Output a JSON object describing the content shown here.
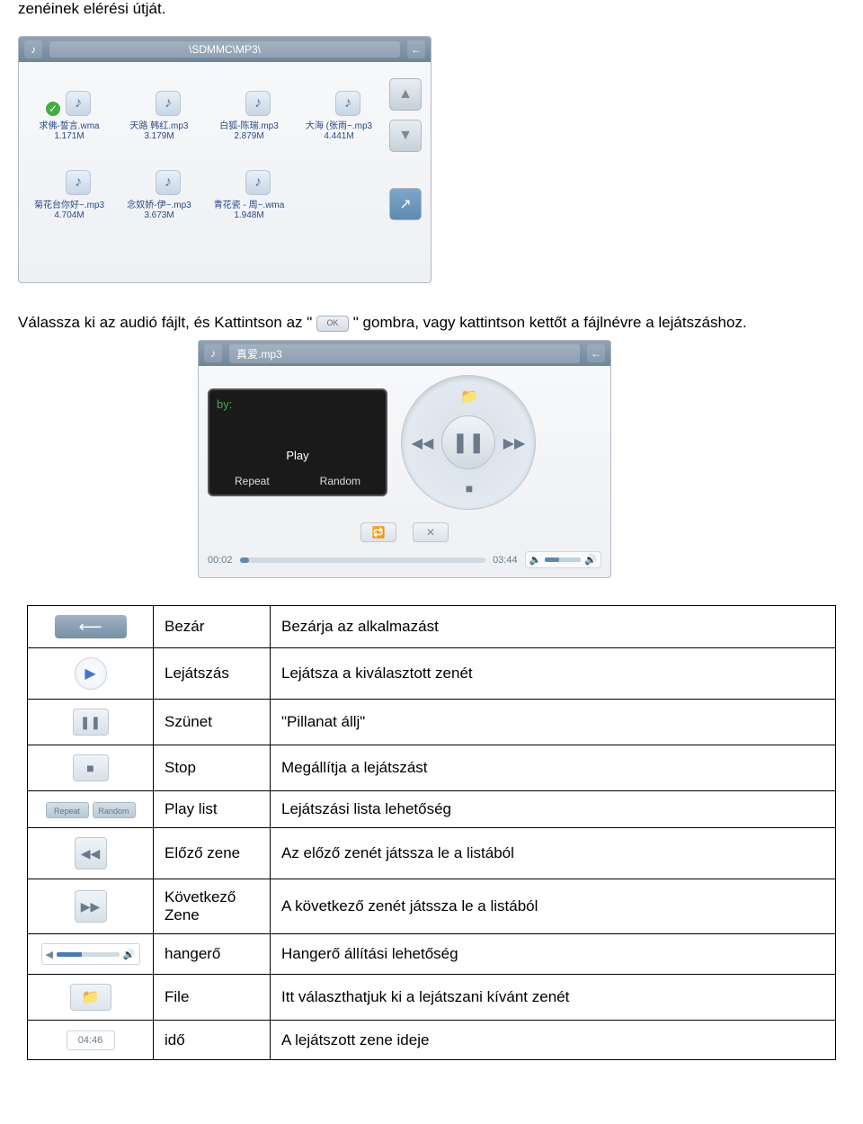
{
  "intro_text": "zenéinek elérési útját.",
  "browser": {
    "path": "\\SDMMC\\MP3\\",
    "files": [
      {
        "name": "求佛-誓言.wma",
        "size": "1.171M",
        "checked": true
      },
      {
        "name": "天路 韩红.mp3",
        "size": "3.179M"
      },
      {
        "name": "白狐-陈瑞.mp3",
        "size": "2.879M"
      },
      {
        "name": "大海 (张雨~.mp3",
        "size": "4.441M"
      },
      {
        "name": "菊花台你好~.mp3",
        "size": "4.704M"
      },
      {
        "name": "念奴娇-伊~.mp3",
        "size": "3.673M"
      },
      {
        "name": "青花瓷 - 周~.wma",
        "size": "1.948M"
      }
    ]
  },
  "paragraph_before": "Válassza ki az audió fájlt, és Kattintson az \"",
  "ok_label": "OK",
  "paragraph_after": "\" gombra, vagy kattintson kettőt a fájlnévre a lejátszáshoz.",
  "player": {
    "title": "真爱.mp3",
    "by": "by:",
    "play": "Play",
    "repeat": "Repeat",
    "random": "Random",
    "time_start": "00:02",
    "time_end": "03:44"
  },
  "rows": [
    {
      "label": "Bezár",
      "desc": "Bezárja az alkalmazást",
      "icon": "back"
    },
    {
      "label": "Lejátszás",
      "desc": "Lejátsza a kiválasztott zenét",
      "icon": "play"
    },
    {
      "label": "Szünet",
      "desc": "\"Pillanat állj\"",
      "icon": "pause"
    },
    {
      "label": "Stop",
      "desc": "Megállítja a lejátszást",
      "icon": "stop"
    },
    {
      "label": "Play list",
      "desc": "Lejátszási lista lehetőség",
      "icon": "modes"
    },
    {
      "label": "Előző zene",
      "desc": "Az előző zenét játssza le a listából",
      "icon": "prev"
    },
    {
      "label": "Következő\nZene",
      "desc": "A következő zenét játssza le a listából",
      "icon": "next"
    },
    {
      "label": "hangerő",
      "desc": "Hangerő állítási lehetőség",
      "icon": "vol"
    },
    {
      "label": "File",
      "desc": "Itt választhatjuk ki a lejátszani kívánt zenét",
      "icon": "file"
    },
    {
      "label": "idő",
      "desc": "A lejátszott zene ideje",
      "icon": "time"
    }
  ],
  "modes_labels": {
    "repeat": "Repeat",
    "random": "Random"
  },
  "time_badge": "04:46"
}
